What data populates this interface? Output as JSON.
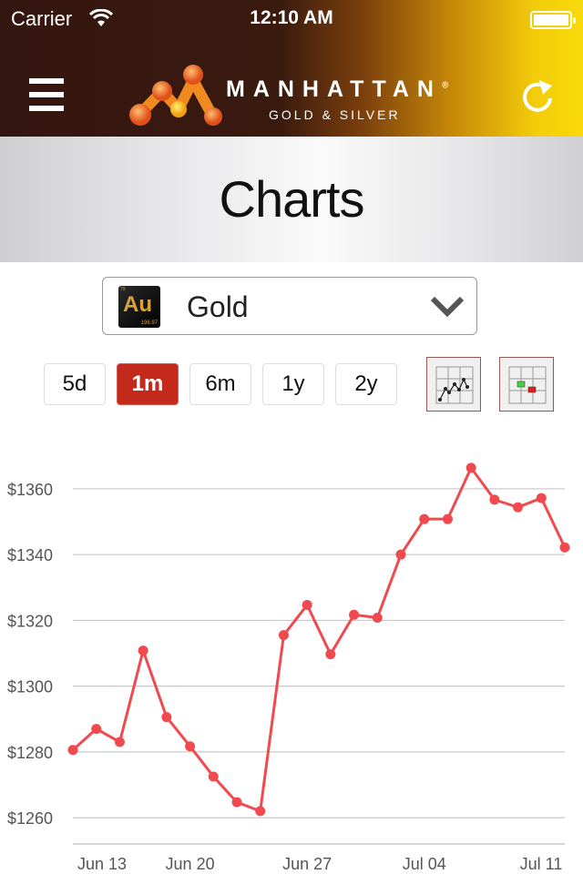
{
  "status_bar": {
    "carrier": "Carrier",
    "time": "12:10 AM"
  },
  "header": {
    "brand": "MANHATTAN",
    "registered": "®",
    "tagline": "GOLD & SILVER"
  },
  "page": {
    "title": "Charts"
  },
  "metal_select": {
    "symbol": "Au",
    "atomic_number": "79",
    "atomic_weight": "196.97",
    "selected": "Gold"
  },
  "ranges": [
    {
      "label": "5d",
      "active": false
    },
    {
      "label": "1m",
      "active": true
    },
    {
      "label": "6m",
      "active": false
    },
    {
      "label": "1y",
      "active": false
    },
    {
      "label": "2y",
      "active": false
    }
  ],
  "chart_types": [
    "line-chart-icon",
    "candlestick-chart-icon"
  ],
  "chart_data": {
    "type": "line",
    "color": "#f04a4f",
    "x": [
      "Jun 13",
      "Jun 14",
      "Jun 15",
      "Jun 16",
      "Jun 17",
      "Jun 20",
      "Jun 21",
      "Jun 22",
      "Jun 23",
      "Jun 24",
      "Jun 27",
      "Jun 28",
      "Jun 29",
      "Jun 30",
      "Jul 01",
      "Jul 04",
      "Jul 05",
      "Jul 06",
      "Jul 07",
      "Jul 08",
      "Jul 11",
      "Jul 12"
    ],
    "values": [
      1280.6,
      1287,
      1283,
      1310.8,
      1290.6,
      1281.7,
      1272.5,
      1264.7,
      1262,
      1315.5,
      1324.7,
      1309.7,
      1321.7,
      1320.8,
      1340,
      1350.8,
      1350.8,
      1366.4,
      1356.7,
      1354.4,
      1357.2,
      1342.2
    ],
    "ylim": [
      1252,
      1373
    ],
    "yticks": [
      1260,
      1280,
      1300,
      1320,
      1340,
      1360
    ],
    "ytick_labels": [
      "$1260",
      "$1280",
      "$1300",
      "$1320",
      "$1340",
      "$1360"
    ],
    "xticks": [
      "Jun 13",
      "Jun 20",
      "Jun 27",
      "Jul 04",
      "Jul 11"
    ],
    "grid": true
  }
}
